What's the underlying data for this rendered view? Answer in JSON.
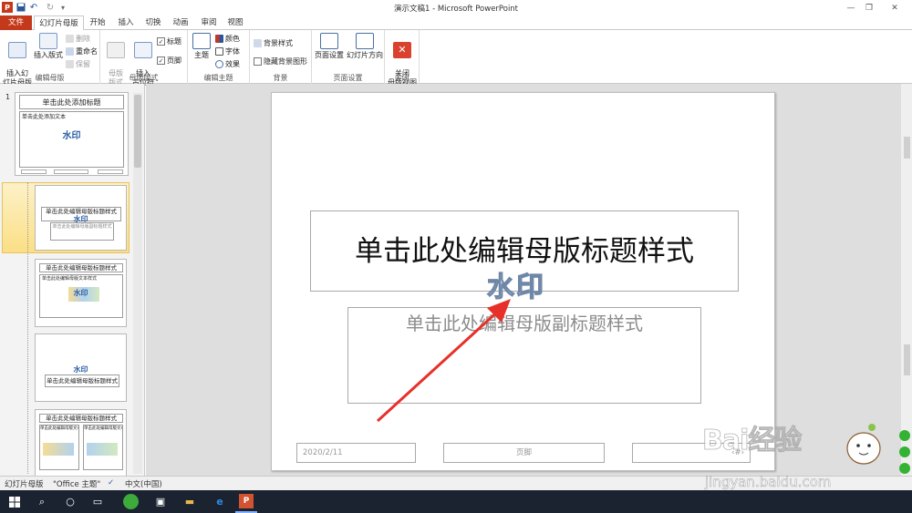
{
  "window": {
    "title": "演示文稿1 - Microsoft PowerPoint",
    "app_icon": "powerpoint-icon",
    "quick_access": [
      "save-icon",
      "undo-icon",
      "redo-icon",
      "customize-icon"
    ]
  },
  "tabs": [
    {
      "label": "文件"
    },
    {
      "label": "幻灯片母版"
    },
    {
      "label": "开始"
    },
    {
      "label": "插入"
    },
    {
      "label": "切换"
    },
    {
      "label": "动画"
    },
    {
      "label": "审阅"
    },
    {
      "label": "视图"
    }
  ],
  "ribbon": {
    "edit_master": {
      "label": "编辑母版",
      "insert_slide_master": "插入幻\n灯片母版",
      "insert_layout": "插入版式",
      "delete": "删除",
      "rename": "重命名",
      "preserve": "保留"
    },
    "master_layout": {
      "label": "母版版式",
      "master_layout_btn": "母版\n版式",
      "insert_placeholder": "插入\n占位符",
      "title_check": "标题",
      "footer_check": "页脚"
    },
    "edit_theme": {
      "label": "编辑主题",
      "themes": "主题",
      "colors": "颜色",
      "fonts": "字体",
      "effects": "效果"
    },
    "background": {
      "label": "背景",
      "background_styles": "背景样式",
      "hide_background": "隐藏背景图形"
    },
    "page_setup": {
      "label": "页面设置",
      "page_setup_btn": "页面设置",
      "slide_orientation": "幻灯片方向"
    },
    "close": {
      "label": "关闭",
      "close_master": "关闭\n母版视图"
    }
  },
  "thumbnails": {
    "first_number": "1",
    "t1": {
      "title": "单击此处添加标题",
      "body": "单击此处添加文本",
      "watermark": "水印"
    },
    "t2": {
      "title": "单击此处编辑母版标题样式",
      "watermark": "水印",
      "subtitle": "单击此处编辑母版副标题样式"
    },
    "t3": {
      "title": "单击此处编辑母版标题样式",
      "body": "单击此处编辑母版文本样式",
      "watermark": "水印"
    },
    "t4": {
      "watermark": "水印",
      "title": "单击此处编辑母版标题样式"
    },
    "t5": {
      "title": "单击此处编辑母版标题样式",
      "left": "单击此处编辑母版文本样式",
      "right": "单击此处编辑母版文本样式"
    }
  },
  "slide": {
    "title": "单击此处编辑母版标题样式",
    "subtitle": "单击此处编辑母版副标题样式",
    "watermark": "水印",
    "date": "2020/2/11",
    "footer": "页脚",
    "page_number": "‹#›"
  },
  "statusbar": {
    "view": "幻灯片母版",
    "theme": "\"Office 主题\"",
    "language": "中文(中国)"
  },
  "overlay": {
    "logo": "Bai经验",
    "url": "jingyan.baidu.com"
  },
  "colors": {
    "file_tab": "#c5391b",
    "arrow": "#e8302a",
    "watermark_text": "#c7d4e6"
  }
}
